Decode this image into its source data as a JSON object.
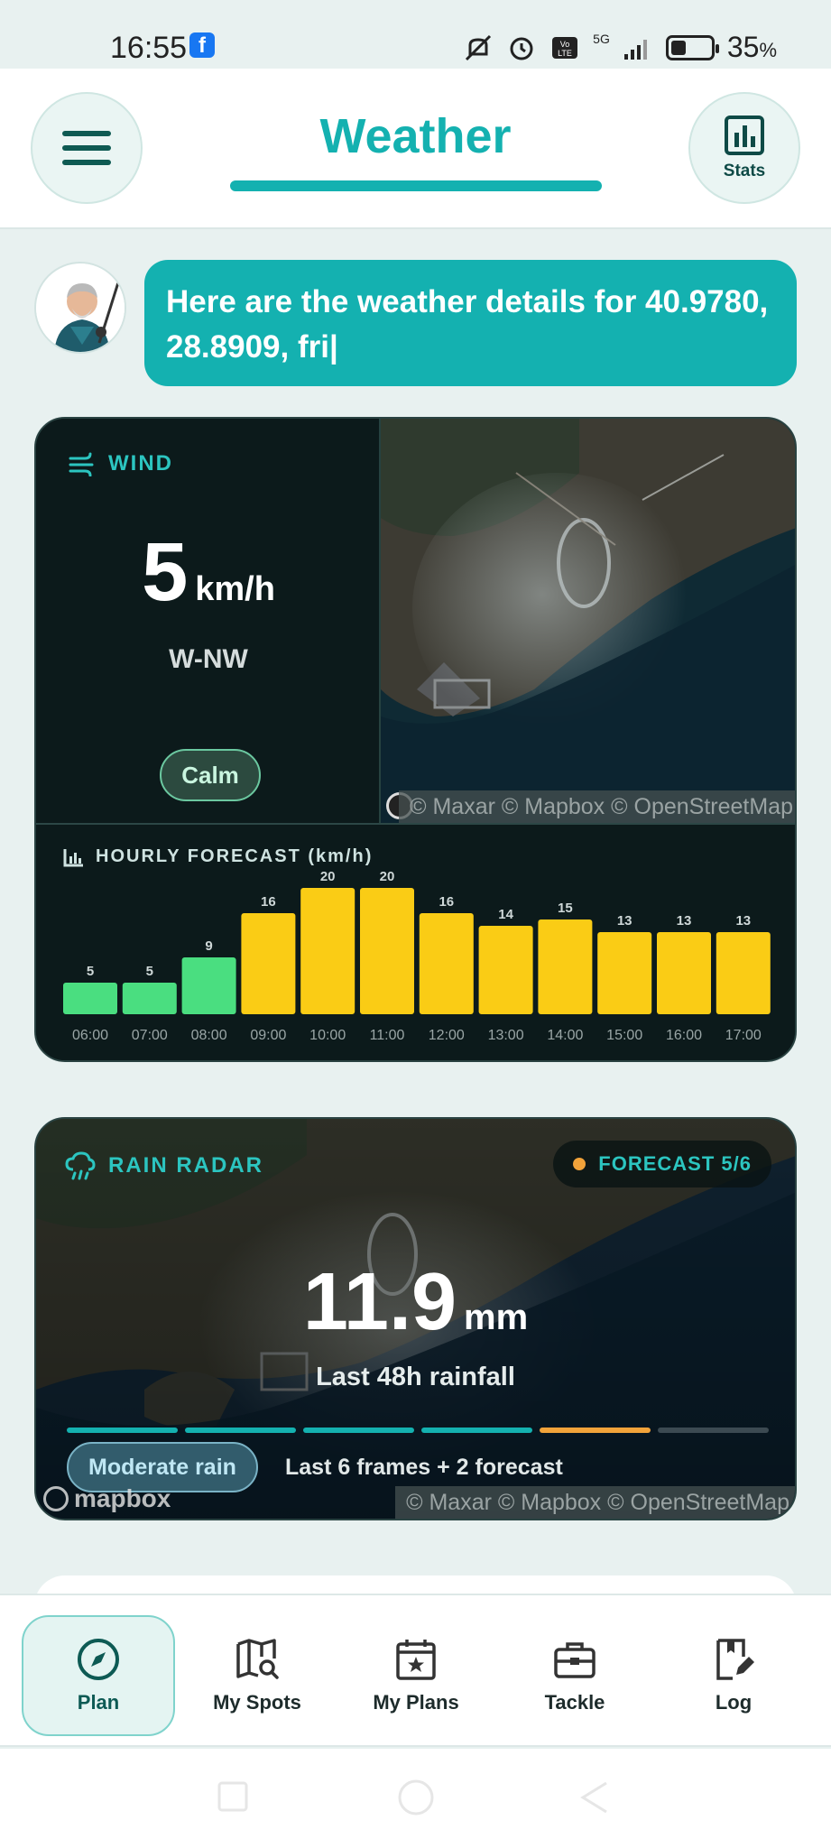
{
  "status_bar": {
    "time": "16:55",
    "app_badge": "f",
    "network": "5G",
    "battery_percent": "35",
    "battery_unit": "%"
  },
  "header": {
    "title": "Weather",
    "stats_label": "Stats"
  },
  "chat": {
    "message": "Here are the weather details for 40.9780, 28.8909, fri|"
  },
  "wind": {
    "label": "WIND",
    "speed": "5",
    "unit": "km/h",
    "direction": "W-NW",
    "condition": "Calm",
    "attribution": "© Maxar © Mapbox © OpenStreetMap"
  },
  "hourly": {
    "label": "HOURLY FORECAST (km/h)",
    "colors": {
      "calm": "#4ade80",
      "moderate": "#facc15"
    }
  },
  "chart_data": {
    "type": "bar",
    "title": "HOURLY FORECAST (km/h)",
    "categories": [
      "06:00",
      "07:00",
      "08:00",
      "09:00",
      "10:00",
      "11:00",
      "12:00",
      "13:00",
      "14:00",
      "15:00",
      "16:00",
      "17:00"
    ],
    "values": [
      5,
      5,
      9,
      16,
      20,
      20,
      16,
      14,
      15,
      13,
      13,
      13
    ],
    "ylim": [
      0,
      20
    ],
    "grid": false
  },
  "rain": {
    "label": "RAIN RADAR",
    "forecast_badge": "FORECAST 5/6",
    "value": "11.9",
    "unit": "mm",
    "subtitle": "Last 48h rainfall",
    "intensity": "Moderate rain",
    "frames_note": "Last 6 frames + 2 forecast",
    "mapbox_logo": "mapbox",
    "attribution": "© Maxar © Mapbox © OpenStreetMap",
    "frame_colors": [
      "#14b1b0",
      "#14b1b0",
      "#14b1b0",
      "#14b1b0",
      "#f2a33a",
      "#3c4a52"
    ]
  },
  "nav": {
    "items": [
      {
        "label": "Plan",
        "icon": "compass-icon"
      },
      {
        "label": "My Spots",
        "icon": "map-search-icon"
      },
      {
        "label": "My Plans",
        "icon": "calendar-star-icon"
      },
      {
        "label": "Tackle",
        "icon": "tackle-box-icon"
      },
      {
        "label": "Log",
        "icon": "logbook-edit-icon"
      }
    ]
  }
}
